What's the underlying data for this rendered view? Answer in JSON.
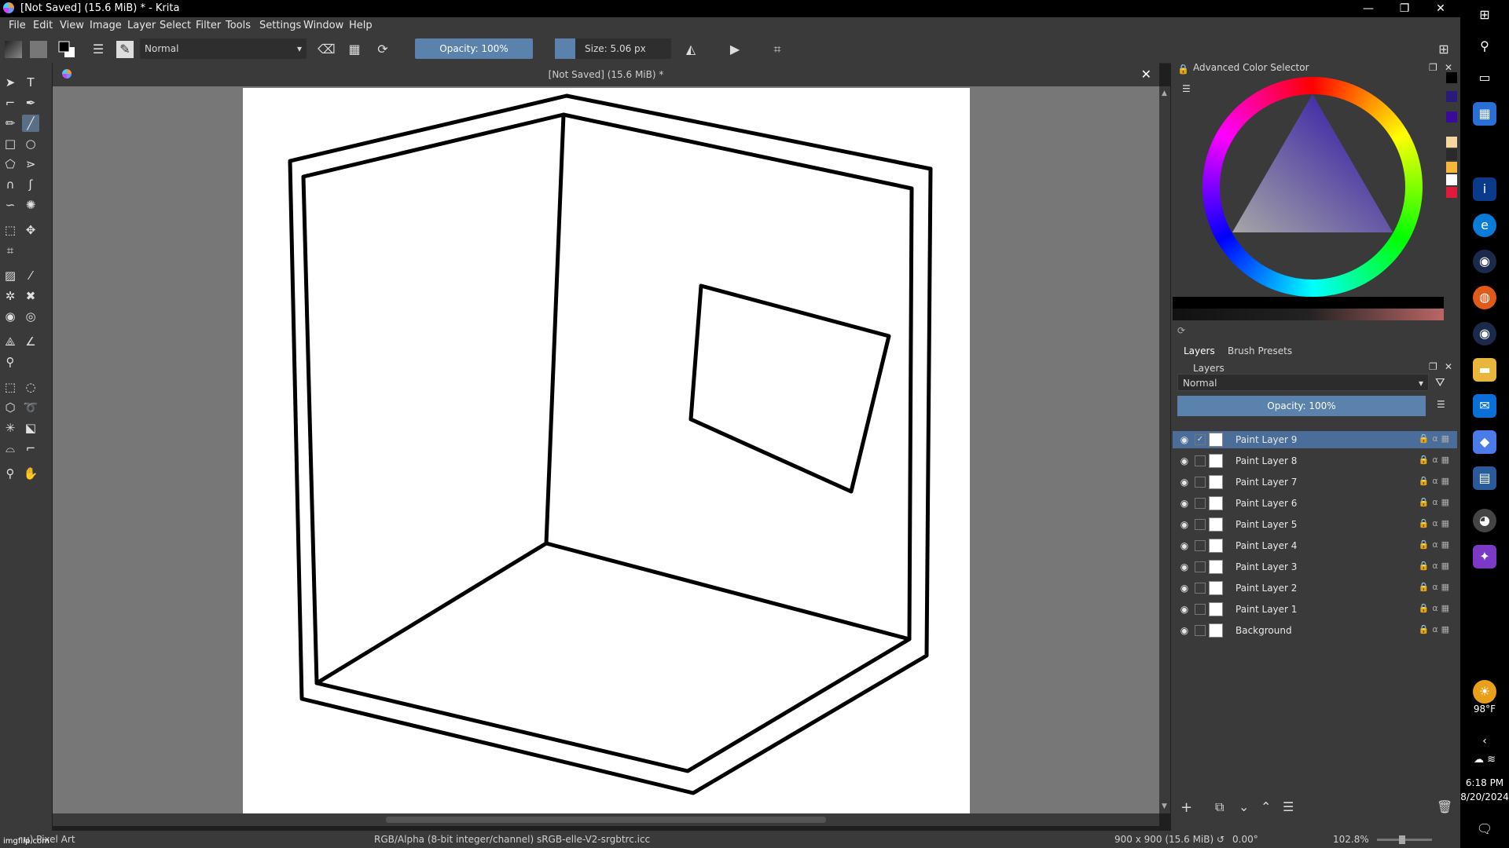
{
  "window": {
    "title": "[Not Saved]  (15.6 MiB) * - Krita",
    "controls": [
      "—",
      "❐",
      "✕"
    ]
  },
  "menu": [
    "File",
    "Edit",
    "View",
    "Image",
    "Layer",
    "Select",
    "Filter",
    "Tools",
    "Settings",
    "Window",
    "Help"
  ],
  "toolbar": {
    "blend_mode": "Normal",
    "opacity_label": "Opacity: 100%",
    "size_label": "Size: 5.06 px"
  },
  "document": {
    "tab_title": "[Not Saved]  (15.6 MiB) *"
  },
  "color_selector": {
    "title": "Advanced Color Selector",
    "swatches": [
      "#000000",
      "#2a1a7a",
      "#3a0a9a",
      "#f6d7a0",
      "#2a2a2a",
      "#f5b63a",
      "#ffffff",
      "#e01a3a"
    ]
  },
  "layers_panel": {
    "tabs": [
      "Layers",
      "Brush Presets"
    ],
    "title": "Layers",
    "blend_mode": "Normal",
    "opacity_label": "Opacity:  100%",
    "layers": [
      {
        "name": "Paint Layer 9",
        "selected": true
      },
      {
        "name": "Paint Layer 8",
        "selected": false
      },
      {
        "name": "Paint Layer 7",
        "selected": false
      },
      {
        "name": "Paint Layer 6",
        "selected": false
      },
      {
        "name": "Paint Layer 5",
        "selected": false
      },
      {
        "name": "Paint Layer 4",
        "selected": false
      },
      {
        "name": "Paint Layer 3",
        "selected": false
      },
      {
        "name": "Paint Layer 2",
        "selected": false
      },
      {
        "name": "Paint Layer 1",
        "selected": false
      },
      {
        "name": "Background",
        "selected": false
      }
    ]
  },
  "status": {
    "brush": "u) Pixel Art",
    "color_profile": "RGB/Alpha (8-bit integer/channel)  sRGB-elle-V2-srgbtrc.icc",
    "image_size": "900 x 900 (15.6 MiB)",
    "rotation": "0.00°",
    "zoom": "102.8%"
  },
  "taskbar": {
    "temperature": "98°F",
    "time": "6:18 PM",
    "date": "8/20/2024"
  },
  "watermark": "imgflip.com"
}
